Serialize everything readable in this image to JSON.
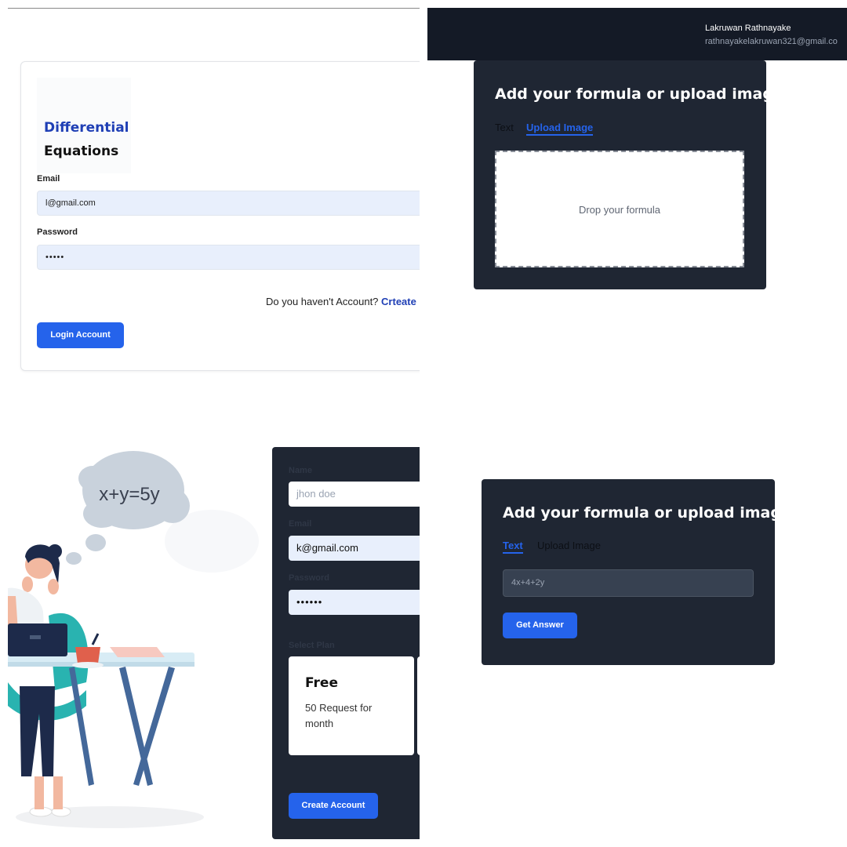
{
  "login": {
    "logo_line1": "Differential",
    "logo_line2": "Equations",
    "email_label": "Email",
    "email_value": "l@gmail.com",
    "password_label": "Password",
    "password_value": "•••••",
    "signup_prompt": "Do you haven't Account?",
    "signup_link": "Crteate",
    "login_button": "Login Account"
  },
  "upload_view": {
    "user_name": "Lakruwan Rathnayake",
    "user_email": "rathnayakelakruwan321@gmail.co",
    "title": "Add your formula or upload image",
    "tab_text": "Text",
    "tab_upload": "Upload Image",
    "active_tab": "Upload Image",
    "drop_text": "Drop your formula"
  },
  "signup": {
    "thought_text": "x+y=5y",
    "name_label": "Name",
    "name_placeholder": "jhon doe",
    "email_label": "Email",
    "email_value": "k@gmail.com",
    "password_label": "Password",
    "password_value": "••••••",
    "plan_label": "Select Plan",
    "plan_name": "Free",
    "plan_desc": "50 Request for month",
    "create_button": "Create Account"
  },
  "text_view": {
    "title": "Add your formula or upload image",
    "tab_text": "Text",
    "tab_upload": "Upload Image",
    "active_tab": "Text",
    "formula_value": "4x+4+2y",
    "answer_button": "Get Answer"
  },
  "colors": {
    "accent": "#2563eb",
    "dark_panel": "#1f2633",
    "header_bar": "#141a26",
    "brand_blue": "#1f3fb5"
  }
}
